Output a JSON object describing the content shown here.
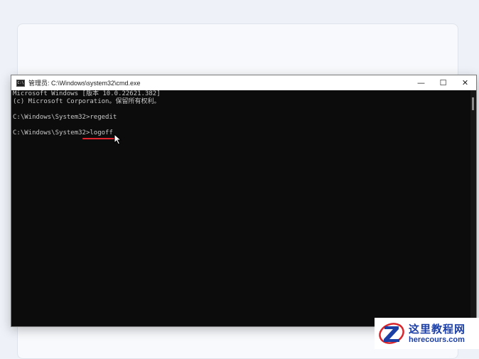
{
  "window": {
    "title": "管理员: C:\\Windows\\system32\\cmd.exe",
    "icon_label": "C:\\",
    "controls": {
      "minimize": "—",
      "maximize": "☐",
      "close": "✕"
    }
  },
  "console": {
    "lines": [
      "Microsoft Windows [版本 10.0.22621.382]",
      "(c) Microsoft Corporation。保留所有权利。",
      "",
      "C:\\Windows\\System32>regedit",
      "",
      "C:\\Windows\\System32>logoff"
    ]
  },
  "colors": {
    "console_bg": "#0c0c0c",
    "console_text": "#c8c8c8",
    "annotation": "#e0242d",
    "watermark": "#1c3fa6"
  },
  "watermark": {
    "name": "这里教程网",
    "url": "herecours.com"
  }
}
